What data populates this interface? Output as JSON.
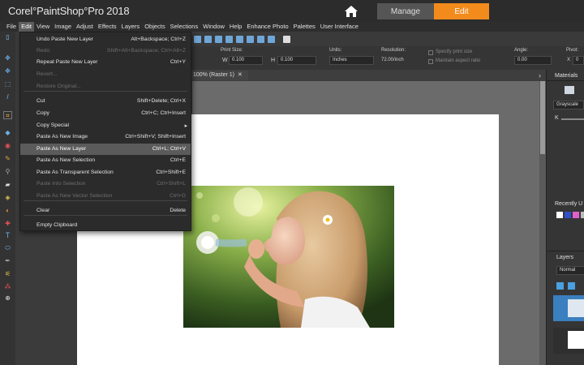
{
  "app": {
    "title": "Corel°PaintShop°Pro 2018"
  },
  "workspace_tabs": {
    "manage": "Manage",
    "edit": "Edit"
  },
  "menubar": [
    "File",
    "Edit",
    "View",
    "Image",
    "Adjust",
    "Effects",
    "Layers",
    "Objects",
    "Selections",
    "Window",
    "Help",
    "Enhance Photo",
    "Palettes",
    "User Interface"
  ],
  "edit_menu": {
    "items": [
      {
        "label": "Undo Paste New Layer",
        "shortcut": "Alt+Backspace; Ctrl+Z",
        "state": "enabled"
      },
      {
        "label": "Redo",
        "shortcut": "Shift+Alt+Backspace; Ctrl+Alt+Z",
        "state": "disabled"
      },
      {
        "label": "Repeat  Paste New Layer",
        "shortcut": "Ctrl+Y",
        "state": "enabled"
      },
      {
        "label": "Revert...",
        "shortcut": "",
        "state": "disabled"
      },
      {
        "label": "Restore Original...",
        "shortcut": "",
        "state": "disabled"
      },
      {
        "label": "Cut",
        "shortcut": "Shift+Delete; Ctrl+X",
        "state": "enabled"
      },
      {
        "label": "Copy",
        "shortcut": "Ctrl+C; Ctrl+Insert",
        "state": "enabled"
      },
      {
        "label": "Copy Special",
        "shortcut": "",
        "state": "enabled",
        "submenu": true
      },
      {
        "label": "Paste As New Image",
        "shortcut": "Ctrl+Shift+V; Shift+Insert",
        "state": "enabled"
      },
      {
        "label": "Paste As New Layer",
        "shortcut": "Ctrl+L; Ctrl+V",
        "state": "highlighted"
      },
      {
        "label": "Paste As New Selection",
        "shortcut": "Ctrl+E",
        "state": "enabled"
      },
      {
        "label": "Paste As Transparent Selection",
        "shortcut": "Ctrl+Shift+E",
        "state": "enabled"
      },
      {
        "label": "Paste Into Selection",
        "shortcut": "Ctrl+Shift+L",
        "state": "disabled"
      },
      {
        "label": "Paste As New Vector Selection",
        "shortcut": "Ctrl+G",
        "state": "disabled"
      },
      {
        "label": "Clear",
        "shortcut": "Delete",
        "state": "enabled"
      },
      {
        "label": "Empty Clipboard",
        "shortcut": "",
        "state": "enabled"
      }
    ]
  },
  "options": {
    "print_size_label": "Print Size:",
    "w_label": "W",
    "w_value": "0.100",
    "h_label": "H",
    "h_value": "0.100",
    "units_label": "Units:",
    "units_value": "Inches",
    "resolution_label": "Resolution:",
    "resolution_value": "72.00/inch",
    "specify_print_size": "Specify print size",
    "maintain_aspect": "Maintain aspect ratio",
    "angle_label": "Angle:",
    "angle_value": "0.00",
    "pivot_label": "Pivot:",
    "pivot_x": "X",
    "pivot_value": "0"
  },
  "document_tab": "100% (Raster 1)",
  "panels": {
    "materials": "Materials",
    "grayscale": "Grayscale",
    "k_label": "K",
    "recently_used": "Recently U",
    "layers": "Layers",
    "blend_mode": "Normal"
  },
  "colors": {
    "accent": "#f28a1c",
    "menu_bg": "#2b2b2b",
    "highlight": "#5b5b5b"
  }
}
